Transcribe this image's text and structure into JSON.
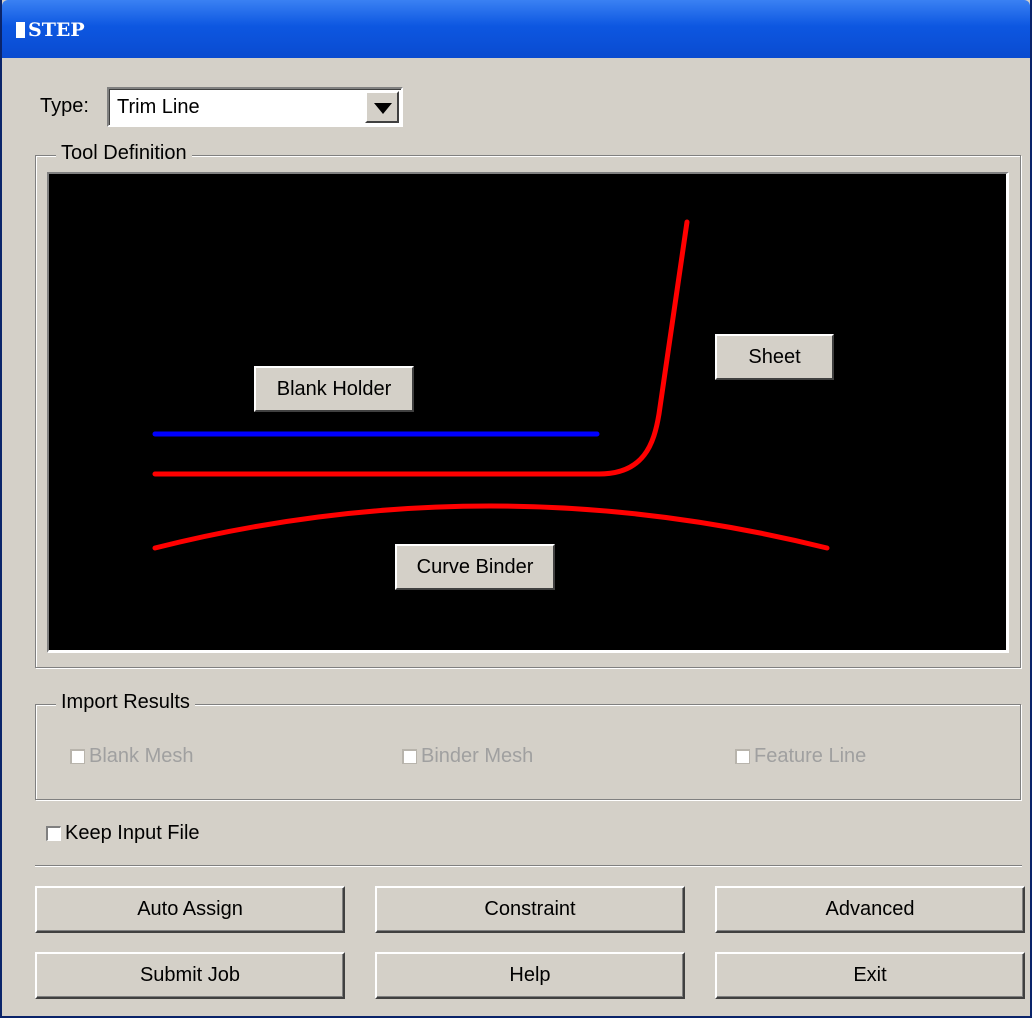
{
  "window": {
    "title": "STEP"
  },
  "type_field": {
    "label": "Type:",
    "value": "Trim Line"
  },
  "tool_definition": {
    "legend": "Tool Definition",
    "labels": {
      "blank_holder": "Blank Holder",
      "sheet": "Sheet",
      "curve_binder": "Curve Binder"
    },
    "colors": {
      "background": "#000000",
      "blank_holder_line": "#0000ff",
      "sheet_line": "#ff0000",
      "binder_line": "#ff0000"
    }
  },
  "import_results": {
    "legend": "Import Results",
    "options": [
      {
        "label": "Blank Mesh",
        "checked": false,
        "enabled": false
      },
      {
        "label": "Binder Mesh",
        "checked": false,
        "enabled": false
      },
      {
        "label": "Feature Line",
        "checked": false,
        "enabled": false
      }
    ]
  },
  "keep_input_file": {
    "label": "Keep Input File",
    "checked": false
  },
  "buttons": {
    "auto_assign": "Auto Assign",
    "constraint": "Constraint",
    "advanced": "Advanced",
    "submit_job": "Submit Job",
    "help": "Help",
    "exit": "Exit"
  }
}
